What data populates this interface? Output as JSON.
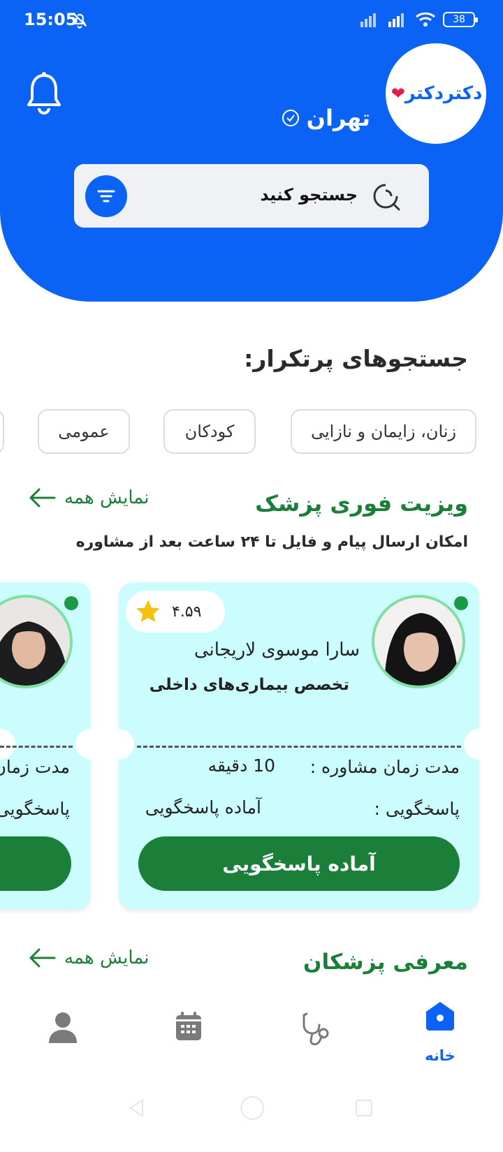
{
  "status_bar": {
    "time": "15:05",
    "battery": "38"
  },
  "header": {
    "logo_text": "دکتردکتر",
    "city": "تهران",
    "search_placeholder": "جستجو کنید"
  },
  "frequent": {
    "title": "جستجوهای پرتکرار:",
    "chips": [
      "زنان، زایمان و نازایی",
      "کودکان",
      "عمومی"
    ]
  },
  "instant_visit": {
    "title": "ویزیت فوری پزشک",
    "show_all": "نمایش همه",
    "subtitle": "امکان ارسال پیام و فایل تا ۲۴ ساعت بعد از مشاوره",
    "doctor": {
      "name": "سارا موسوی لاریجانی",
      "specialty": "تخصص بیماری‌های داخلی",
      "rating": "۴.۵۹",
      "duration_label": "مدت زمان مشاوره :",
      "duration_value": "10 دقیقه",
      "response_label": "پاسخگویی :",
      "response_value": "آماده پاسخگویی",
      "button": "آماده پاسخگویی"
    },
    "peek": {
      "duration_label": "مدت زمان",
      "response_label": "پاسخگویی"
    }
  },
  "doctors_intro": {
    "title": "معرفی پزشکان",
    "show_all": "نمایش همه"
  },
  "bottom_nav": {
    "home_label": "خانه"
  },
  "colors": {
    "primary": "#0b63f6",
    "green": "#1b7f3a",
    "card": "#cbfdfe"
  }
}
